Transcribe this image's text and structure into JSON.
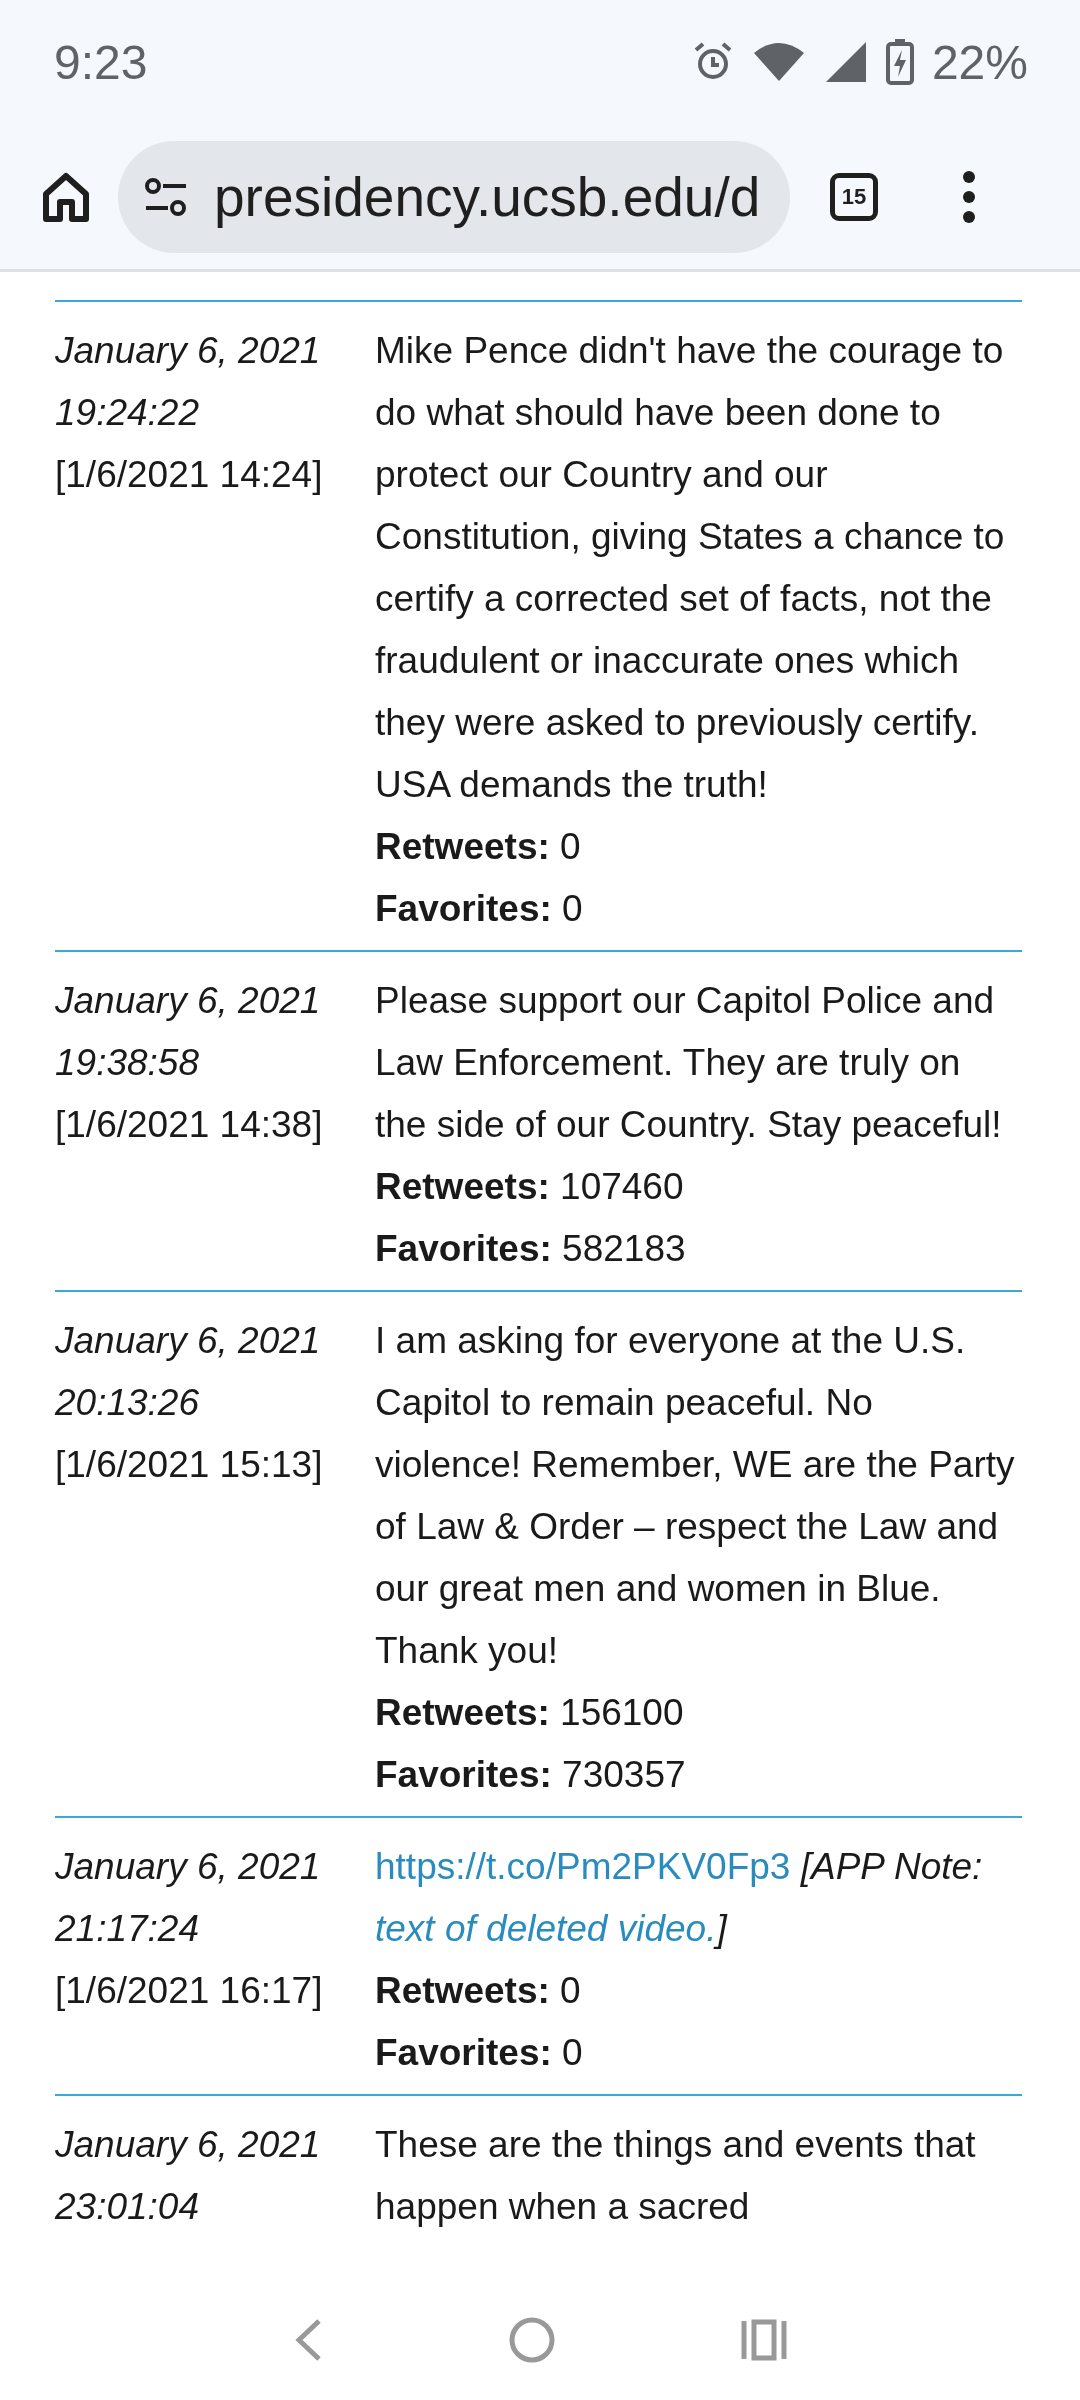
{
  "status_bar": {
    "time": "9:23",
    "battery": "22%"
  },
  "browser": {
    "url": "presidency.ucsb.edu/d",
    "tab_count": "15"
  },
  "tweets": [
    {
      "date": "January 6, 2021",
      "time": "19:24:22",
      "local": "[1/6/2021 14:24]",
      "body": [
        {
          "kind": "text",
          "text": "Mike Pence didn't have the courage to do what should have been done to protect our Country and our Constitution, giving States a chance to certify a corrected set of facts, not the fraudulent or inaccurate ones which they were asked to previously certify. USA demands the truth!"
        }
      ],
      "stats": [
        {
          "label": "Retweets:",
          "value": "0"
        },
        {
          "label": "Favorites:",
          "value": "0"
        }
      ]
    },
    {
      "date": "January 6, 2021",
      "time": "19:38:58",
      "local": "[1/6/2021 14:38]",
      "body": [
        {
          "kind": "text",
          "text": "Please support our Capitol Police and Law Enforcement. They are truly on the side of our Country. Stay peaceful!"
        }
      ],
      "stats": [
        {
          "label": "Retweets:",
          "value": "107460"
        },
        {
          "label": "Favorites:",
          "value": "582183"
        }
      ]
    },
    {
      "date": "January 6, 2021",
      "time": "20:13:26",
      "local": "[1/6/2021 15:13]",
      "body": [
        {
          "kind": "text",
          "text": "I am asking for everyone at the U.S. Capitol to remain peaceful. No violence! Remember, WE are the Party of Law & Order – respect the Law and our great men and women in Blue. Thank you!"
        }
      ],
      "stats": [
        {
          "label": "Retweets:",
          "value": "156100"
        },
        {
          "label": "Favorites:",
          "value": "730357"
        }
      ]
    },
    {
      "date": "January 6, 2021",
      "time": "21:17:24",
      "local": "[1/6/2021 16:17]",
      "body": [
        {
          "kind": "link",
          "text": "https://t.co/Pm2PKV0Fp3"
        },
        {
          "kind": "note",
          "text": "[APP Note:"
        },
        {
          "kind": "note_link",
          "text": "text of deleted video."
        },
        {
          "kind": "note",
          "text": "]"
        }
      ],
      "stats": [
        {
          "label": "Retweets:",
          "value": "0"
        },
        {
          "label": "Favorites:",
          "value": "0"
        }
      ]
    },
    {
      "date": "January 6, 2021",
      "time": "23:01:04",
      "body": [
        {
          "kind": "text",
          "text": "These are the things and events that happen when a sacred"
        }
      ]
    }
  ]
}
